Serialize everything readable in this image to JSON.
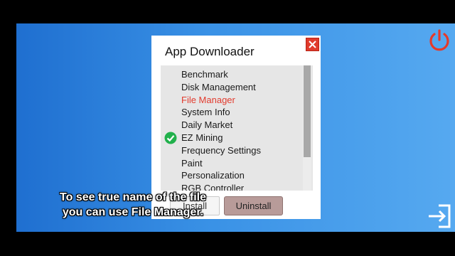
{
  "dialog": {
    "title": "App Downloader",
    "apps": [
      {
        "label": "Benchmark",
        "highlighted": false,
        "installed": false
      },
      {
        "label": "Disk Management",
        "highlighted": false,
        "installed": false
      },
      {
        "label": "File Manager",
        "highlighted": true,
        "installed": false
      },
      {
        "label": "System Info",
        "highlighted": false,
        "installed": false
      },
      {
        "label": "Daily Market",
        "highlighted": false,
        "installed": false
      },
      {
        "label": "EZ Mining",
        "highlighted": false,
        "installed": true
      },
      {
        "label": "Frequency Settings",
        "highlighted": false,
        "installed": false
      },
      {
        "label": "Paint",
        "highlighted": false,
        "installed": false
      },
      {
        "label": "Personalization",
        "highlighted": false,
        "installed": false
      },
      {
        "label": "RGB Controller",
        "highlighted": false,
        "installed": false
      }
    ],
    "install_label": "Install",
    "uninstall_label": "Uninstall"
  },
  "caption": {
    "line1": "To see true name of the file",
    "line2": "you can use File Manager."
  },
  "icons": {
    "close": "close-icon",
    "power": "power-icon",
    "exit": "exit-icon",
    "installed_check": "check-icon"
  },
  "colors": {
    "desktop_start": "#1f6fd0",
    "desktop_end": "#56a9f0",
    "highlight_text": "#e23b2e",
    "close_button": "#e03a2b",
    "power_icon": "#e53a2a",
    "check": "#22b14c",
    "uninstall_button": "#b89b99"
  }
}
